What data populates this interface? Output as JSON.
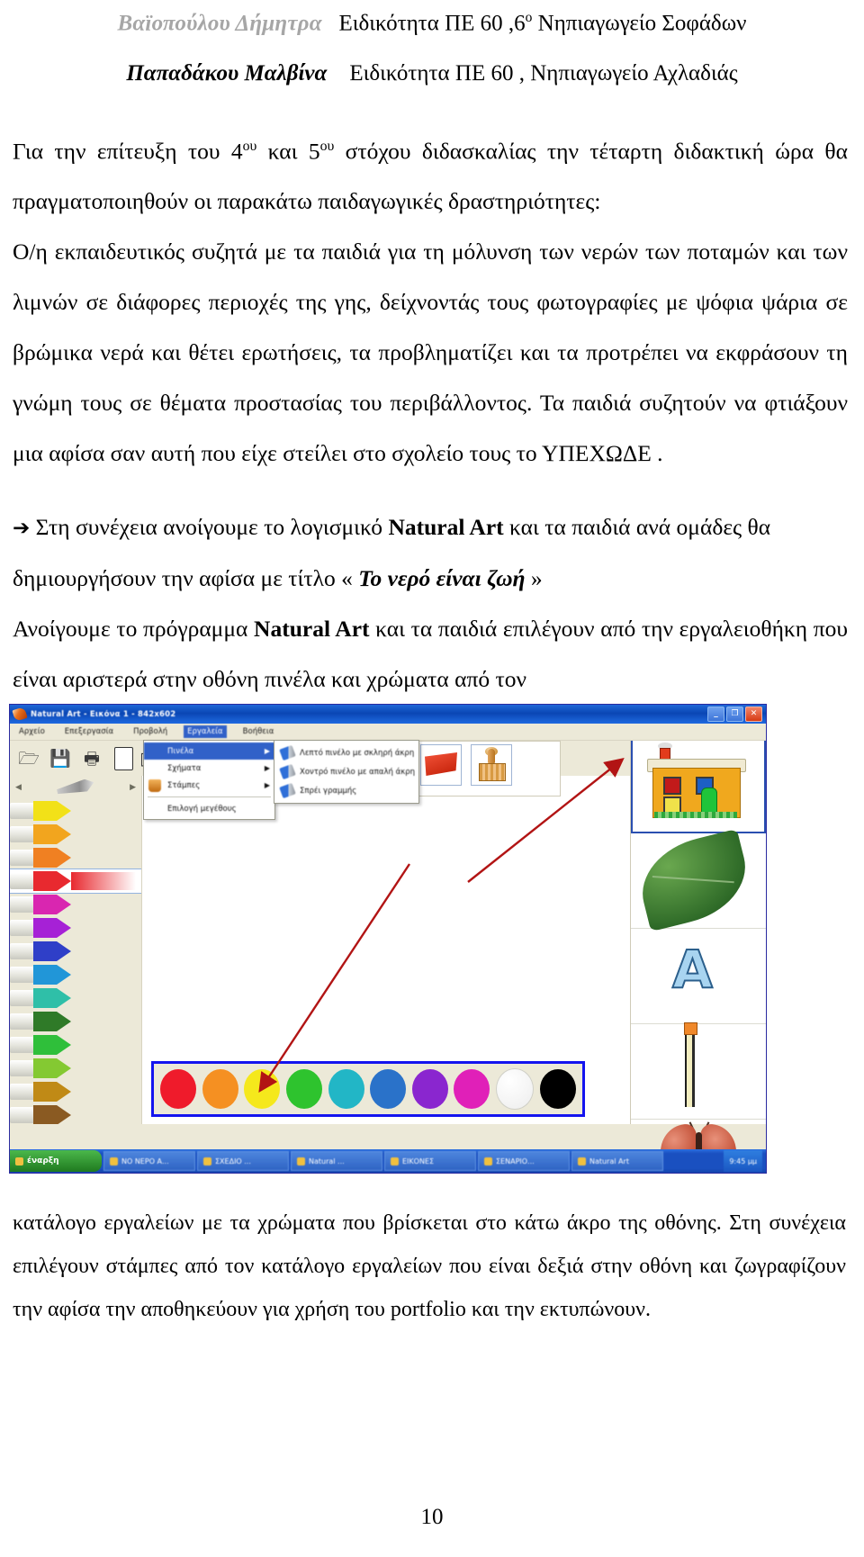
{
  "document": {
    "header": {
      "line1": {
        "author": "Βαϊοπούλου Δήμητρα",
        "rest": "Ειδικότητα ΠΕ 60 ,6ο Νηπιαγωγείο Σοφάδων",
        "sup": "ο",
        "rest_a": "Ειδικότητα ΠΕ 60 ,6",
        "rest_b": " Νηπιαγωγείο Σοφάδων"
      },
      "line2": {
        "author": "Παπαδάκου Μαλβίνα",
        "rest": "Ειδικότητα ΠΕ 60 , Νηπιαγωγείο Αχλαδιάς"
      }
    },
    "paragraphs": {
      "p1_a": "Για την επίτευξη του 4",
      "p1_sup1": "ου",
      "p1_b": " και 5",
      "p1_sup2": "ου",
      "p1_c": " στόχου διδασκαλίας την τέταρτη διδακτική ώρα θα πραγματοποιηθούν οι παρακάτω παιδαγωγικές δραστηριότητες:",
      "p2": "Ο/η εκπαιδευτικός συζητά με τα παιδιά για τη μόλυνση των νερών των ποταμών και των λιμνών  σε διάφορες περιοχές της γης, δείχνοντάς τους φωτογραφίες με ψόφια ψάρια  σε βρώμικα νερά και θέτει ερωτήσεις, τα προβληματίζει και τα προτρέπει να εκφράσουν τη γνώμη τους σε θέματα προστασίας του περιβάλλοντος. Τα παιδιά συζητούν να φτιάξουν μια αφίσα σαν αυτή που είχε στείλει στο σχολείο τους το ΥΠΕΧΩΔΕ .",
      "p3_arrow": "➔",
      "p3_a": " Στη συνέχεια ανοίγουμε το λογισμικό ",
      "p3_bold": "Natural Art",
      "p3_b": " και τα παιδιά ανά ομάδες θα  δημιουργήσουν την αφίσα με τίτλο « ",
      "p3_title": "Το νερό είναι ζωή",
      "p3_c": " »",
      "p4_a": "Ανοίγουμε το πρόγραμμα ",
      "p4_bold": "Natural Art",
      "p4_b": " και τα παιδιά επιλέγουν από την εργαλειοθήκη  που είναι αριστερά στην οθόνη πινέλα  και χρώματα από τον",
      "p5": "κατάλογο εργαλείων  με τα χρώματα  που βρίσκεται στο κάτω άκρο της οθόνης. Στη συνέχεια επιλέγουν στάμπες     από τον κατάλογο εργαλείων που είναι δεξιά στην οθόνη και ζωγραφίζουν την αφίσα την αποθηκεύουν για χρήση του portfolio και την εκτυπώνουν."
    },
    "page_number": "10"
  },
  "app_window": {
    "title": "Natural Art - Εικόνα 1 - 842x602",
    "window_buttons": {
      "minimize": "_",
      "maximize": "❐",
      "close": "✕"
    },
    "menubar": [
      {
        "label": "Αρχείο",
        "selected": false
      },
      {
        "label": "Επεξεργασία",
        "selected": false
      },
      {
        "label": "Προβολή",
        "selected": false
      },
      {
        "label": "Εργαλεία",
        "selected": true
      },
      {
        "label": "Βοήθεια",
        "selected": false
      }
    ],
    "toolbar": [
      {
        "icon": "open-folder-icon"
      },
      {
        "icon": "save-disk-icon"
      },
      {
        "icon": "print-icon"
      },
      {
        "icon": "new-page-icon"
      },
      {
        "icon": "eraser-icon"
      }
    ],
    "open_menu": {
      "items": [
        {
          "label": "Πινέλα",
          "highlighted": true,
          "submenu": true
        },
        {
          "label": "Σχήματα",
          "highlighted": false,
          "submenu": true
        },
        {
          "label": "Στάμπες",
          "highlighted": false,
          "submenu": true
        }
      ],
      "footer_item": "Επιλογή μεγέθους"
    },
    "submenu": {
      "items": [
        "Λεπτό πινέλο με σκληρή άκρη",
        "Χοντρό πινέλο με απαλή άκρη",
        "Σπρέι γραμμής"
      ]
    },
    "big_buttons": [
      {
        "name": "flag-tool-button",
        "icon": "flag-icon"
      },
      {
        "name": "stamp-tool-button",
        "icon": "stamp-icon"
      }
    ],
    "markers": {
      "header_icon": "pencil-icon",
      "left_arrow": "◀",
      "right_arrow": "▶",
      "colors": [
        "#f2e118",
        "#f2a51e",
        "#f08022",
        "#e8292f",
        "#d926b0",
        "#a621d6",
        "#2f3fc8",
        "#2196d8",
        "#2fbfa8",
        "#2f7a28",
        "#2fbf3a",
        "#84c932",
        "#c08a16",
        "#8a5a22",
        "#b01c22",
        "#a42090",
        "#7b3ec8",
        "#3a5aa8"
      ],
      "selected_index": 3
    },
    "palette": {
      "swatches": [
        "#ef1b2b",
        "#f59022",
        "#f5e81c",
        "#2ec32e",
        "#22b6c6",
        "#2a72c9",
        "#8a26cf",
        "#e020b8",
        "#ffffff",
        "#000000"
      ],
      "border_color": "#1414ef"
    },
    "stamps": [
      {
        "name": "house-stamp",
        "selected": true
      },
      {
        "name": "leaf-stamp",
        "selected": false
      },
      {
        "name": "letter-a-stamp",
        "label": "A",
        "selected": false
      },
      {
        "name": "pencil-stamp",
        "selected": false
      },
      {
        "name": "butterfly-stamp",
        "selected": false
      }
    ],
    "taskbar": {
      "start": "έναρξη",
      "items": [
        "ΝΟ ΝΕΡΟ Α...",
        "ΣΧΕΔΙΟ ...",
        "Natural ...",
        "ΕΙΚΟΝΕΣ",
        "ΣΕΝΑΡΙΟ...",
        "Natural Art"
      ],
      "tray": "9:45 μμ"
    }
  }
}
